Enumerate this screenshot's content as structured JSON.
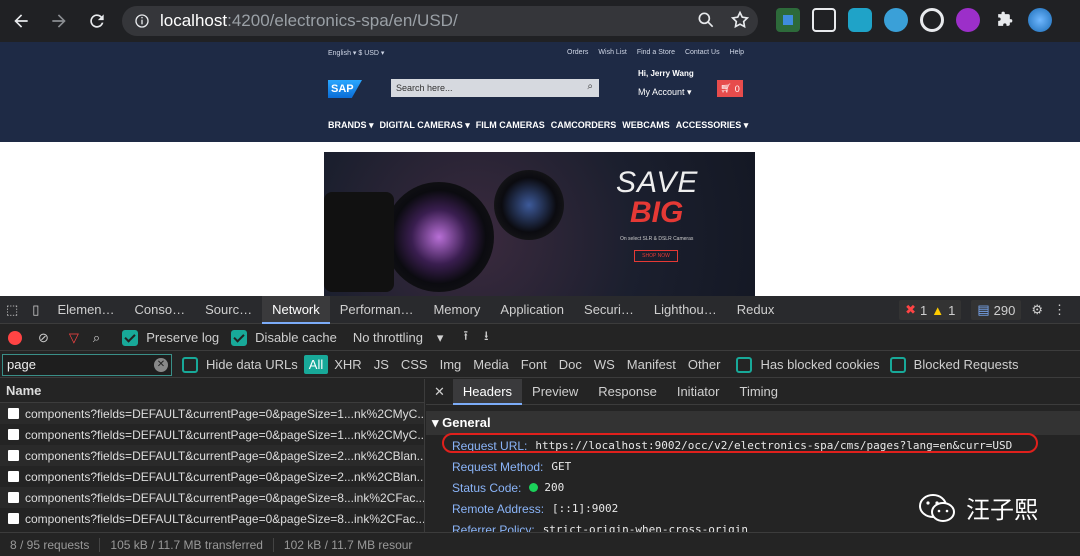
{
  "browser": {
    "url_host": "localhost",
    "url_port_path": ":4200/electronics-spa/en/USD/"
  },
  "site": {
    "lang": "English ▾  $ USD ▾",
    "util_links": [
      "Orders",
      "Wish List",
      "Find a Store",
      "Contact Us",
      "Help"
    ],
    "logo": "SAP",
    "search_placeholder": "Search here...",
    "greeting": "Hi, Jerry Wang",
    "my_account": "My Account ▾",
    "cart_count": "0",
    "nav": [
      "BRANDS ▾",
      "DIGITAL CAMERAS ▾",
      "FILM CAMERAS",
      "CAMCORDERS",
      "WEBCAMS",
      "ACCESSORIES ▾"
    ],
    "banner": {
      "save": "SAVE",
      "big": "BIG",
      "sub": "On select SLR & DSLR Cameras",
      "shop": "SHOP NOW"
    }
  },
  "devtools": {
    "tabs": [
      "Elemen…",
      "Conso…",
      "Sourc…",
      "Network",
      "Performan…",
      "Memory",
      "Application",
      "Securi…",
      "Lighthou…",
      "Redux"
    ],
    "active_tab": "Network",
    "errors": "1",
    "warnings": "1",
    "messages": "290",
    "preserve_log": "Preserve log",
    "disable_cache": "Disable cache",
    "throttling": "No throttling",
    "filter_value": "page",
    "hide_data_urls": "Hide data URLs",
    "type_filters": [
      "All",
      "XHR",
      "JS",
      "CSS",
      "Img",
      "Media",
      "Font",
      "Doc",
      "WS",
      "Manifest",
      "Other"
    ],
    "has_blocked_cookies": "Has blocked cookies",
    "blocked_requests": "Blocked Requests",
    "name_header": "Name",
    "requests": [
      "components?fields=DEFAULT&currentPage=0&pageSize=1...nk%2CMyC...",
      "components?fields=DEFAULT&currentPage=0&pageSize=1...nk%2CMyC...",
      "components?fields=DEFAULT&currentPage=0&pageSize=2...nk%2CBlan...",
      "components?fields=DEFAULT&currentPage=0&pageSize=2...nk%2CBlan...",
      "components?fields=DEFAULT&currentPage=0&pageSize=8...ink%2CFac...",
      "components?fields=DEFAULT&currentPage=0&pageSize=8...ink%2CFac..."
    ],
    "detail_tabs": [
      "Headers",
      "Preview",
      "Response",
      "Initiator",
      "Timing"
    ],
    "general_header": "General",
    "general": {
      "request_url_label": "Request URL:",
      "request_url": "https://localhost:9002/occ/v2/electronics-spa/cms/pages?lang=en&curr=USD",
      "request_method_label": "Request Method:",
      "request_method": "GET",
      "status_code_label": "Status Code:",
      "status_code": "200",
      "remote_address_label": "Remote Address:",
      "remote_address": "[::1]:9002",
      "referrer_policy_label": "Referrer Policy:",
      "referrer_policy": "strict-origin-when-cross-origin"
    },
    "status": {
      "requests": "8 / 95 requests",
      "transferred": "105 kB / 11.7 MB transferred",
      "resources": "102 kB / 11.7 MB resour"
    }
  },
  "watermark": "汪子熙"
}
